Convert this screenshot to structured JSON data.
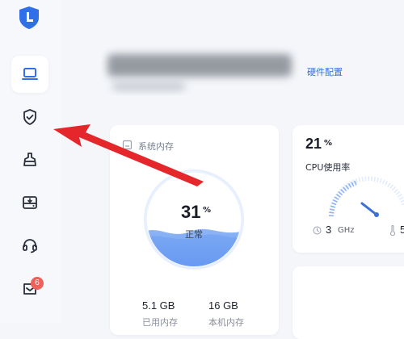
{
  "app": {
    "accent_color": "#2f6fe8",
    "logo_icon": "shield-L-logo"
  },
  "sidebar": {
    "items": [
      {
        "icon": "laptop-icon",
        "active": true
      },
      {
        "icon": "shield-check-icon",
        "active": false
      },
      {
        "icon": "cleanup-icon",
        "active": false
      },
      {
        "icon": "disk-icon",
        "active": false
      },
      {
        "icon": "headset-icon",
        "active": false
      },
      {
        "icon": "message-icon",
        "active": false,
        "badge": "6"
      }
    ]
  },
  "header": {
    "hardware_link": "硬件配置"
  },
  "memory": {
    "title": "系统内存",
    "percent": "31",
    "percent_unit": "%",
    "status": "正常",
    "used": "5.1 GB",
    "used_label": "已用内存",
    "total": "16 GB",
    "total_label": "本机内存"
  },
  "cpu": {
    "percent": "21",
    "percent_unit": "%",
    "label": "CPU使用率",
    "freq_value": "3",
    "freq_unit": "GHz",
    "temp_value": "5"
  },
  "colors": {
    "wave": "#6b9ef2",
    "arrow": "#e5262b",
    "badge": "#f0605a"
  }
}
